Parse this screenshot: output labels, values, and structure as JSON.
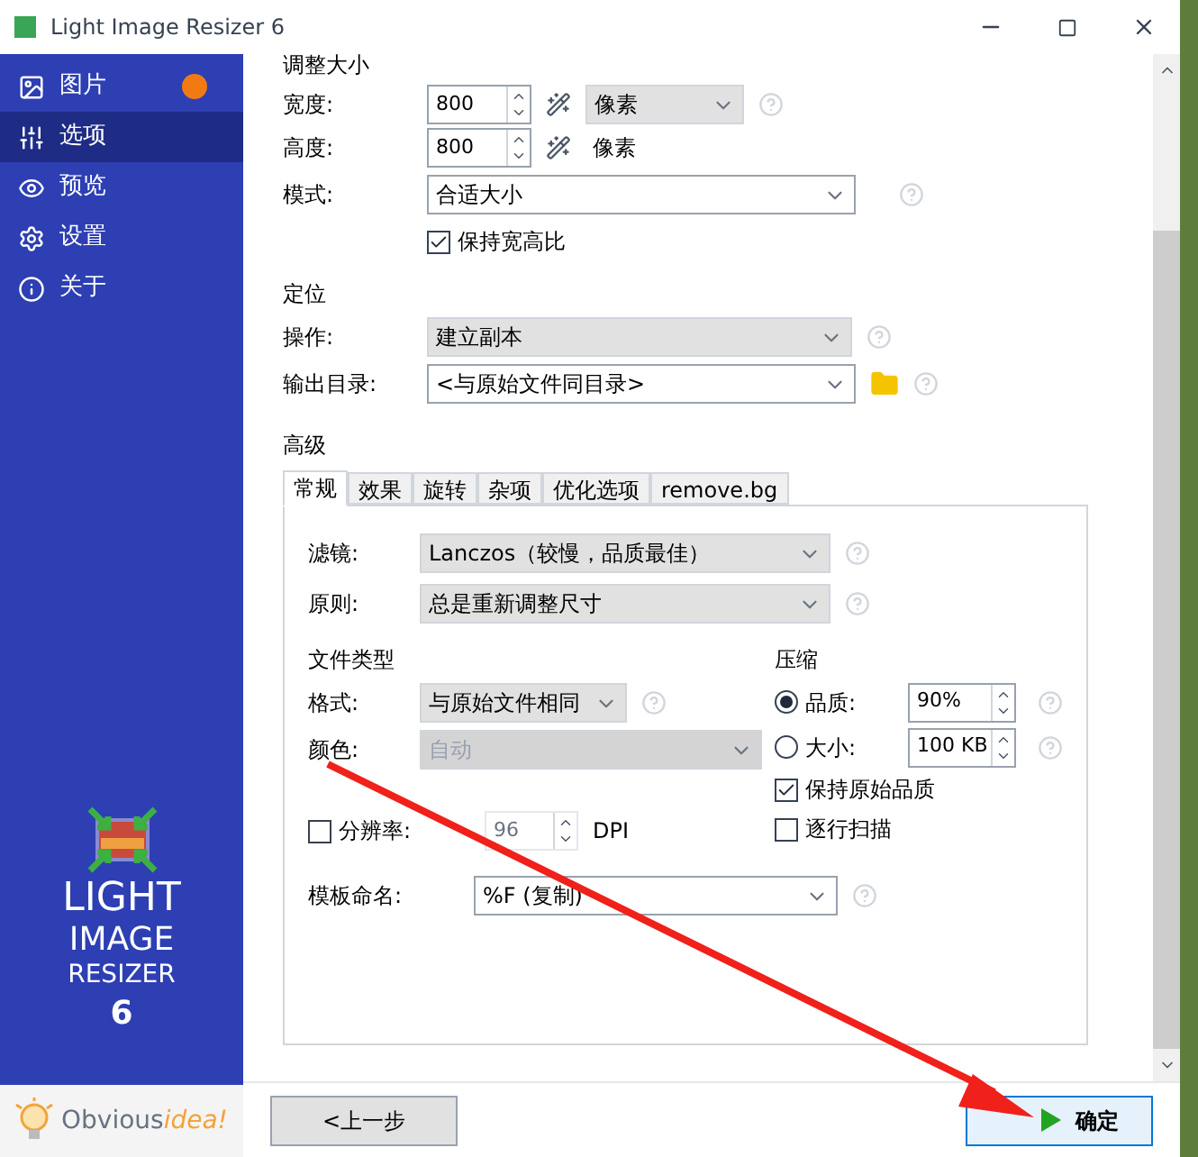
{
  "window": {
    "title": "Light Image Resizer 6"
  },
  "sidebar": {
    "items": [
      {
        "label": "图片",
        "selected": false,
        "badge": true
      },
      {
        "label": "选项",
        "selected": true,
        "badge": false
      },
      {
        "label": "预览",
        "selected": false,
        "badge": false
      },
      {
        "label": "设置",
        "selected": false,
        "badge": false
      },
      {
        "label": "关于",
        "selected": false,
        "badge": false
      }
    ],
    "logo": [
      "LIGHT",
      "IMAGE",
      "RESIZER",
      "6"
    ],
    "brand": {
      "first": "Obvious",
      "second": "idea!"
    }
  },
  "resize": {
    "heading": "调整大小",
    "width": {
      "label": "宽度:",
      "value": "800",
      "unit": "像素"
    },
    "height": {
      "label": "高度:",
      "value": "800",
      "unit": "像素"
    },
    "mode": {
      "label": "模式:",
      "value": "合适大小"
    },
    "keep_ratio": {
      "label": "保持宽高比",
      "checked": true
    }
  },
  "position": {
    "heading": "定位",
    "operation": {
      "label": "操作:",
      "value": "建立副本"
    },
    "output": {
      "label": "输出目录:",
      "value": "<与原始文件同目录>"
    }
  },
  "advanced": {
    "heading": "高级",
    "tabs": [
      {
        "label": "常规",
        "selected": true
      },
      {
        "label": "效果",
        "selected": false
      },
      {
        "label": "旋转",
        "selected": false
      },
      {
        "label": "杂项",
        "selected": false
      },
      {
        "label": "优化选项",
        "selected": false
      },
      {
        "label": "remove.bg",
        "selected": false
      }
    ],
    "filter": {
      "label": "滤镜:",
      "value": "Lanczos（较慢，品质最佳）"
    },
    "rule": {
      "label": "原则:",
      "value": "总是重新调整尺寸"
    },
    "file_type": {
      "heading": "文件类型",
      "format": {
        "label": "格式:",
        "value": "与原始文件相同",
        "disabled": false
      },
      "color": {
        "label": "颜色:",
        "value": "自动",
        "disabled": true
      }
    },
    "compression": {
      "heading": "压缩",
      "options": [
        {
          "label": "品质:",
          "value": "90%",
          "selected": true
        },
        {
          "label": "大小:",
          "value": "100 KB",
          "selected": false
        }
      ],
      "keep_quality": {
        "label": "保持原始品质",
        "checked": true
      },
      "scan": {
        "label": "逐行扫描",
        "checked": false
      }
    },
    "resolution": {
      "label": "分辨率:",
      "checked": false,
      "value": "96",
      "unit": "DPI",
      "disabled": true
    },
    "template": {
      "label": "模板命名:",
      "value": "%F (复制)"
    }
  },
  "buttons": {
    "back": "<上一步",
    "ok": "确定"
  }
}
